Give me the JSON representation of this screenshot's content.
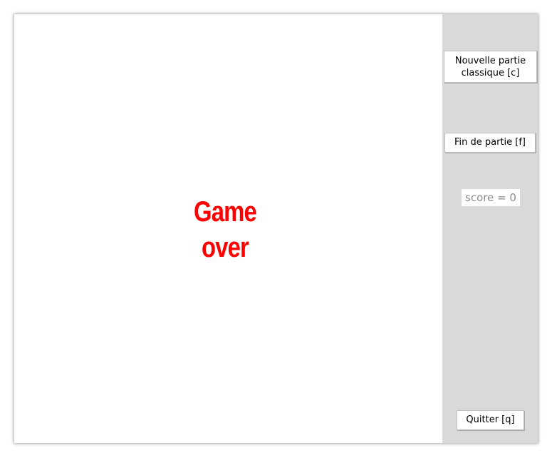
{
  "game": {
    "status_line1": "Game",
    "status_line2": "over",
    "status_color": "#ff0000"
  },
  "sidebar": {
    "background": "#d9d9d9",
    "new_game_line1": "Nouvelle partie",
    "new_game_line2": "classique [c]",
    "end_game_label": "Fin de partie [f]",
    "score_text": "score = 0",
    "quit_label": "Quitter [q]"
  }
}
